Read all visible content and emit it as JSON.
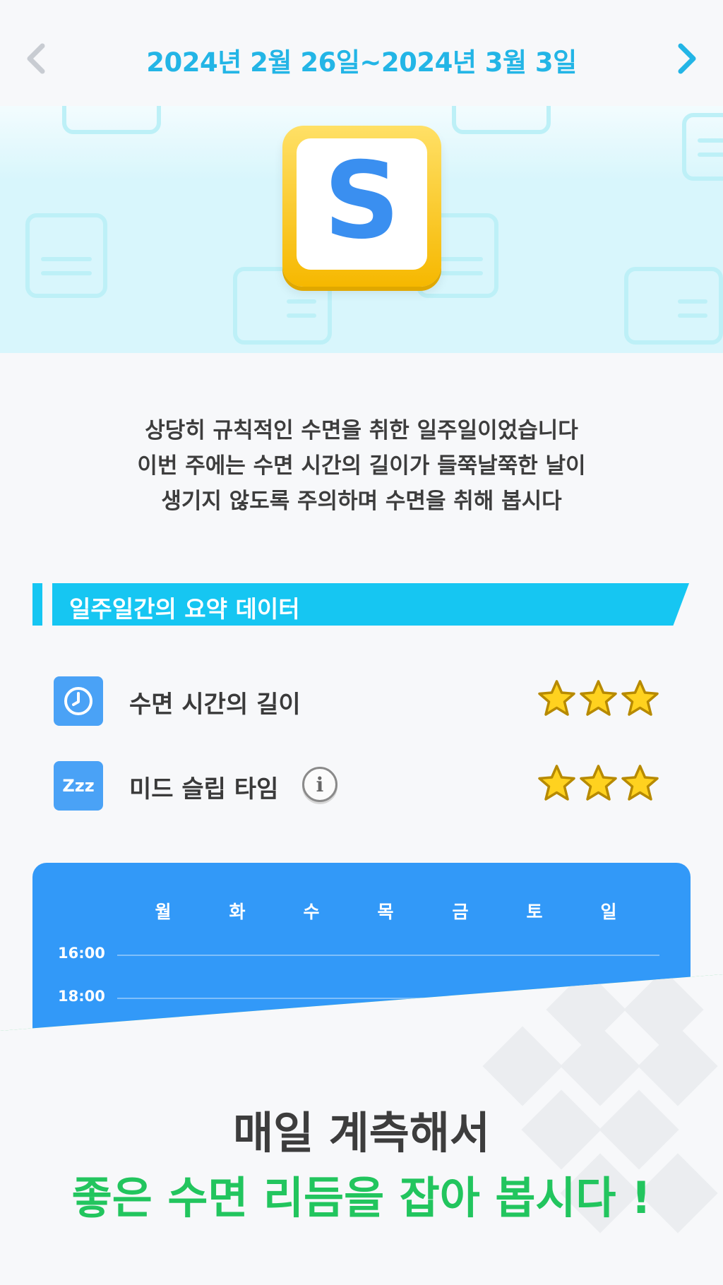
{
  "header": {
    "date_range": "2024년 2월 26일~2024년 3월 3일",
    "prev_icon": "chevron-left-icon",
    "next_icon": "chevron-right-icon",
    "prev_color": "#c8ccd2",
    "next_color": "#23b5e6"
  },
  "rank": {
    "letter": "S",
    "badge_color": "#f6c21a",
    "letter_color": "#3a8ff0"
  },
  "message": {
    "lines": [
      "상당히 규칙적인 수면을 취한 일주일이었습니다",
      "이번 주에는 수면 시간의 길이가 들쭉날쭉한 날이",
      "생기지 않도록 주의하며 수면을 취해 봅시다"
    ]
  },
  "summary": {
    "title": "일주일간의 요약 데이터",
    "accent_color": "#16c6f2",
    "metrics": [
      {
        "icon": "clock-icon",
        "label": "수면 시간의 길이",
        "stars": 3
      },
      {
        "icon": "zzz-icon",
        "label": "미드 슬립 타임",
        "icon_text": "Zzz",
        "info_icon": "info-icon",
        "info_text": "i",
        "stars": 3
      }
    ]
  },
  "chart": {
    "days": [
      "월",
      "화",
      "수",
      "목",
      "금",
      "토",
      "일"
    ],
    "times": [
      "16:00",
      "18:00"
    ],
    "background": "#3299f8"
  },
  "promo": {
    "line1": "매일 계측해서",
    "line2": "좋은 수면 리듬을 잡아 봅시다 !",
    "accent_color": "#22c55e"
  }
}
